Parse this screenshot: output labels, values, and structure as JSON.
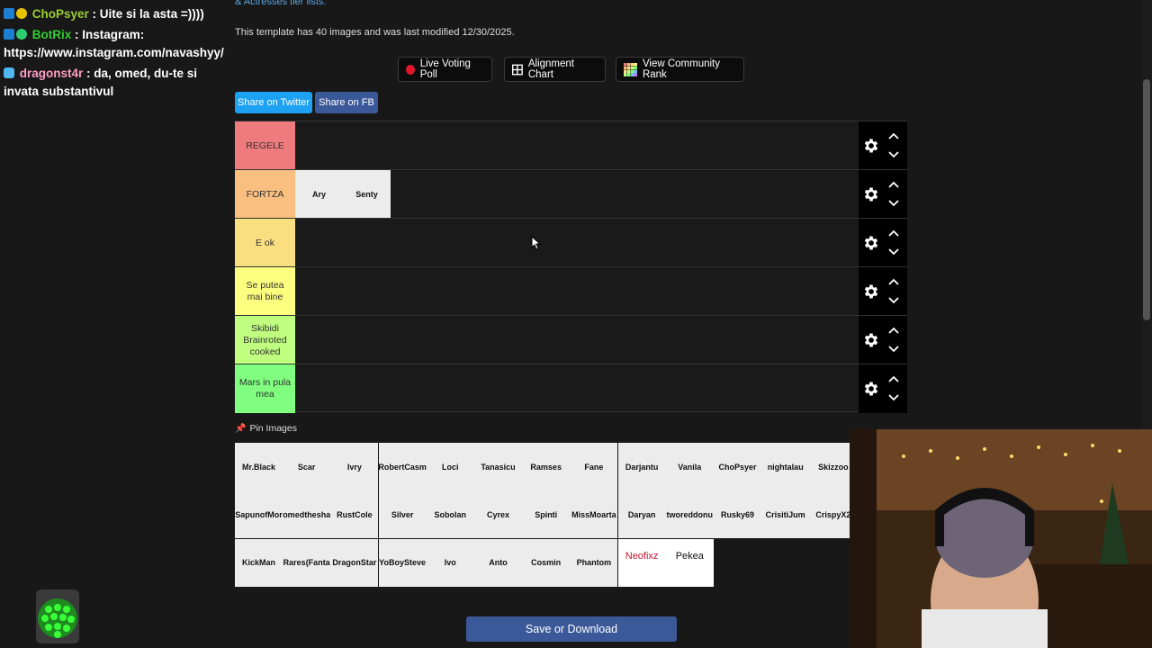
{
  "chat": {
    "messages": [
      {
        "user": "ChoPsyer",
        "text": " : Uite si la asta =))))",
        "color": "#9acd32"
      },
      {
        "user": "BotRix",
        "text": " : Instagram: https://www.instagram.com/navashyy/",
        "color": "#32cd32"
      },
      {
        "user": "dragonst4r",
        "text": " : da, omed, du-te si invata substantivul",
        "color": "#ff9ec4"
      }
    ]
  },
  "page": {
    "top_link": "& Actresses tier lists.",
    "info": "This template has 40 images and was last modified 12/30/2025.",
    "buttons": {
      "live_poll": "Live Voting Poll",
      "alignment": "Alignment Chart",
      "community": "View Community Rank",
      "share_twitter": "Share on Twitter",
      "share_fb": "Share on FB",
      "save": "Save or Download"
    },
    "pin_label": "Pin Images",
    "colors": {
      "twitter": "#1da1f2",
      "fb": "#3b5998",
      "poll_dot": "#e0162b"
    }
  },
  "tiers": [
    {
      "label": "REGELE",
      "color": "#f07b7f",
      "items": []
    },
    {
      "label": "FORTZA",
      "color": "#f9bf7f",
      "items": [
        "Ary",
        "Senty"
      ]
    },
    {
      "label": "E ok",
      "color": "#f9df7f",
      "items": []
    },
    {
      "label": "Se putea mai bine",
      "color": "#fdfe7f",
      "items": []
    },
    {
      "label": "Skibidi Brainroted cooked",
      "color": "#bffe7f",
      "items": []
    },
    {
      "label": "Mars in pula mea",
      "color": "#7ffe7f",
      "items": []
    }
  ],
  "pool": [
    [
      "Mr.Black",
      "Scar",
      "Ivry",
      "RobertCasm",
      "Loci",
      "Tanasicu",
      "Ramses",
      "Fane",
      "Darjantu",
      "Vanila",
      "ChoPsyer",
      "nightalau",
      "Skizzoo"
    ],
    [
      "SapunofMor",
      "omedthesha",
      "RustCole",
      "Silver",
      "Sobolan",
      "Cyrex",
      "Spinti",
      "MissMoarta",
      "Daryan",
      "tworeddonu",
      "Rusky69",
      "CrisitiJum",
      "CrispyX2"
    ],
    [
      "KickMan",
      "Rares(Fanta",
      "DragonStar",
      "YoBoySteve",
      "Ivo",
      "Anto",
      "Cosmin",
      "Phantom",
      "Neofixz",
      "Pekea"
    ]
  ]
}
